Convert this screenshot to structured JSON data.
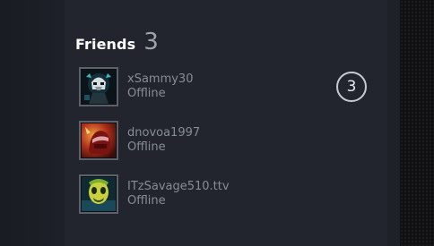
{
  "friends_section": {
    "title": "Friends",
    "count": "3",
    "badge": "3",
    "items": [
      {
        "name": "xSammy30",
        "status": "Offline",
        "avatar_icon": "skull-knight-avatar"
      },
      {
        "name": "dnovoa1997",
        "status": "Offline",
        "avatar_icon": "red-helmet-avatar"
      },
      {
        "name": "ITzSavage510.ttv",
        "status": "Offline",
        "avatar_icon": "green-ghoul-avatar"
      }
    ]
  },
  "colors": {
    "panel_bg": "#22252e",
    "text_muted": "#878c96",
    "title": "#ffffff",
    "count": "#9ea3ad",
    "badge_border": "#c7cad0"
  }
}
